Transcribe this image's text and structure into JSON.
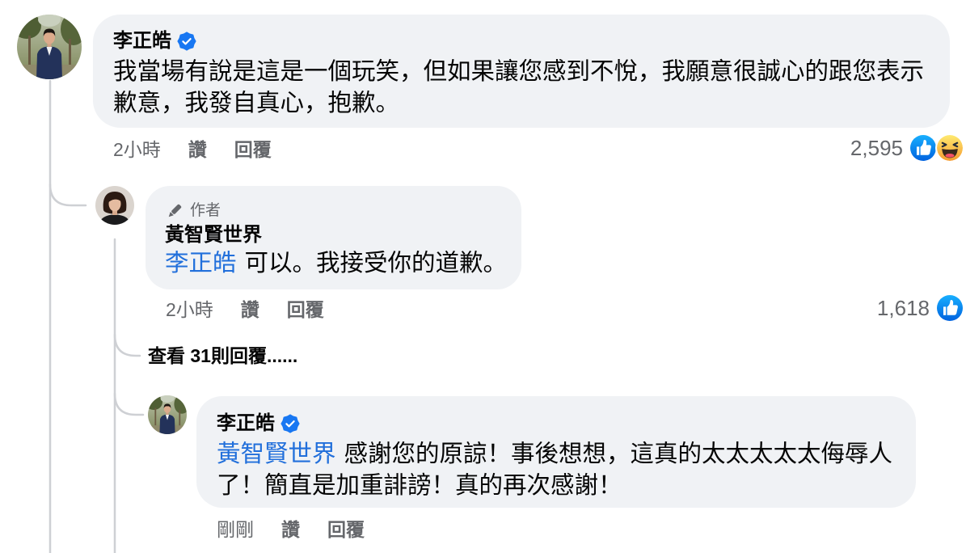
{
  "colors": {
    "background": "#ffffff",
    "bubble": "#f0f2f5",
    "text": "#050505",
    "secondary_text": "#65676b",
    "mention": "#216fdb",
    "verified_badge": "#1877f2",
    "thread_line": "#ced0d4"
  },
  "thread": [
    {
      "author": "李正皓",
      "verified": true,
      "body_lines": [
        "我當場有說是這是一個玩笑，但如果讓您感到不悅，我願意很誠心的跟您表示",
        "歉意，我發自真心，抱歉。"
      ],
      "time": "2小時",
      "like_label": "讚",
      "reply_label": "回覆",
      "reaction_count": "2,595",
      "reaction_icons": [
        "like-icon",
        "haha-icon"
      ]
    },
    {
      "author_badge": "作者",
      "author_badge_icon": "pen-icon",
      "author": "黃智賢世界",
      "verified": false,
      "mention": "李正皓",
      "body_lines": [
        "可以。我接受你的道歉。"
      ],
      "time": "2小時",
      "like_label": "讚",
      "reply_label": "回覆",
      "reaction_count": "1,618",
      "reaction_icons": [
        "like-icon"
      ]
    },
    {
      "author": "李正皓",
      "verified": true,
      "mention": "黃智賢世界",
      "body_lines": [
        "感謝您的原諒！事後想想，這真的太太太太太侮辱人",
        "了！簡直是加重誹謗！真的再次感謝！"
      ],
      "time": "剛剛",
      "like_label": "讚",
      "reply_label": "回覆"
    }
  ],
  "view_more_replies": "查看 31則回覆......"
}
